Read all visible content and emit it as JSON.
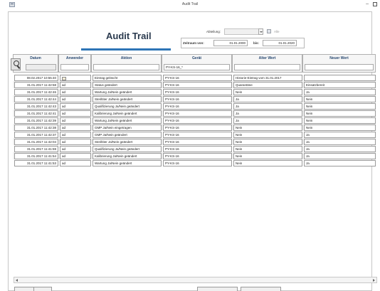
{
  "window": {
    "title": "Audit Trail"
  },
  "header": {
    "title": "Audit Trail",
    "abteilung_label": "Abteilung:",
    "abteilung_value": "",
    "alle_label": "Alle",
    "zeitraum_label": "Zeitraum von:",
    "date_from": "01.01.2000",
    "bis_label": "bis:",
    "date_to": "01.01.2020"
  },
  "columns": [
    {
      "label": "Datum",
      "filter": ""
    },
    {
      "label": "Anwender",
      "filter": ""
    },
    {
      "label": "Aktion",
      "filter": ""
    },
    {
      "label": "Gerät",
      "filter": "PY-KS-16_*"
    },
    {
      "label": "Alter Wert",
      "filter": ""
    },
    {
      "label": "Neuer Wert",
      "filter": ""
    }
  ],
  "rows": [
    {
      "datum": "08.02.2017 10:55:40",
      "anwender": "",
      "aktion": "Eintrag gelöscht",
      "geraet": "PY-KS-16",
      "alter_wert": "Historie-Eintrag vom 31.01.2017",
      "neuer_wert": ""
    },
    {
      "datum": "31.01.2017 11:42:58",
      "anwender": "ad",
      "aktion": "Status geändert",
      "geraet": "PY-KS-16",
      "alter_wert": "Quarantäne",
      "neuer_wert": "Einsatzbereit"
    },
    {
      "datum": "31.01.2017 11:42:46",
      "anwender": "ad",
      "aktion": "Wartung Ja/Nein geändert",
      "geraet": "PY-KS-16",
      "alter_wert": "Nein",
      "neuer_wert": "Ja"
    },
    {
      "datum": "31.01.2017 11:42:44",
      "anwender": "ad",
      "aktion": "Steriltiter Ja/Nein geändert",
      "geraet": "PY-KS-16",
      "alter_wert": "Ja",
      "neuer_wert": "Nein"
    },
    {
      "datum": "31.01.2017 11:42:43",
      "anwender": "ad",
      "aktion": "Qualifizierung Ja/Nein geändert",
      "geraet": "PY-KS-16",
      "alter_wert": "Ja",
      "neuer_wert": "Nein"
    },
    {
      "datum": "31.01.2017 11:42:41",
      "anwender": "ad",
      "aktion": "Kalibrierung Ja/Nein geändert",
      "geraet": "PY-KS-16",
      "alter_wert": "Ja",
      "neuer_wert": "Nein"
    },
    {
      "datum": "31.01.2017 11:42:39",
      "anwender": "ad",
      "aktion": "Wartung Ja/Nein geändert",
      "geraet": "PY-KS-16",
      "alter_wert": "Ja",
      "neuer_wert": "Nein"
    },
    {
      "datum": "31.01.2017 11:42:38",
      "anwender": "ad",
      "aktion": "GMP Ja/Nein eingetragen",
      "geraet": "PY-KS-16",
      "alter_wert": "Nein",
      "neuer_wert": "Nein"
    },
    {
      "datum": "31.01.2017 11:42:37",
      "anwender": "ad",
      "aktion": "GMP Ja/Nein geändert",
      "geraet": "PY-KS-16",
      "alter_wert": "Nein",
      "neuer_wert": "Ja"
    },
    {
      "datum": "31.01.2017 11:42:04",
      "anwender": "ad",
      "aktion": "Steriltiter Ja/Nein geändert",
      "geraet": "PY-KS-16",
      "alter_wert": "Nein",
      "neuer_wert": "Ja"
    },
    {
      "datum": "31.01.2017 11:41:59",
      "anwender": "ad",
      "aktion": "Qualifizierung Ja/Nein geändert",
      "geraet": "PY-KS-16",
      "alter_wert": "Nein",
      "neuer_wert": "Ja"
    },
    {
      "datum": "31.01.2017 11:41:54",
      "anwender": "ad",
      "aktion": "Kalibrierung Ja/Nein geändert",
      "geraet": "PY-KS-16",
      "alter_wert": "Nein",
      "neuer_wert": "Ja"
    },
    {
      "datum": "31.01.2017 11:41:53",
      "anwender": "ad",
      "aktion": "Wartung Ja/Nein geändert",
      "geraet": "PY-KS-16",
      "alter_wert": "Nein",
      "neuer_wert": "Ja"
    }
  ],
  "icons": {
    "app": "form-icon",
    "filter": "search-icon",
    "calendar": "calendar-icon",
    "user_placeholder": "note-icon"
  },
  "colors": {
    "accent": "#2e75b6",
    "title": "#2a3a4e",
    "header_text": "#2a4a72"
  }
}
